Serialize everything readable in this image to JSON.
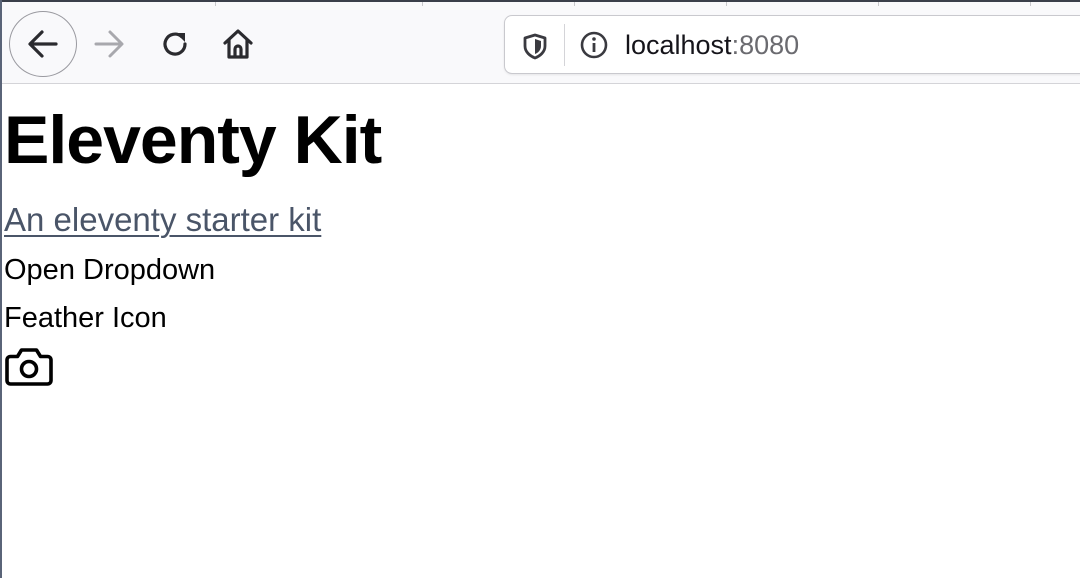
{
  "browser": {
    "url_host": "localhost",
    "url_port": ":8080",
    "icons": {
      "back": "back-arrow-icon",
      "forward": "forward-arrow-icon",
      "reload": "reload-icon",
      "home": "home-icon",
      "shield": "shield-icon",
      "info": "info-icon"
    }
  },
  "page": {
    "title": "Eleventy Kit",
    "tagline": "An eleventy starter kit",
    "dropdown_label": "Open Dropdown",
    "feather_label": "Feather Icon",
    "feather_icon": "camera-icon"
  },
  "colors": {
    "tagline": "#4a5568",
    "text": "#000000",
    "toolbar_bg": "#f9f9fb"
  }
}
